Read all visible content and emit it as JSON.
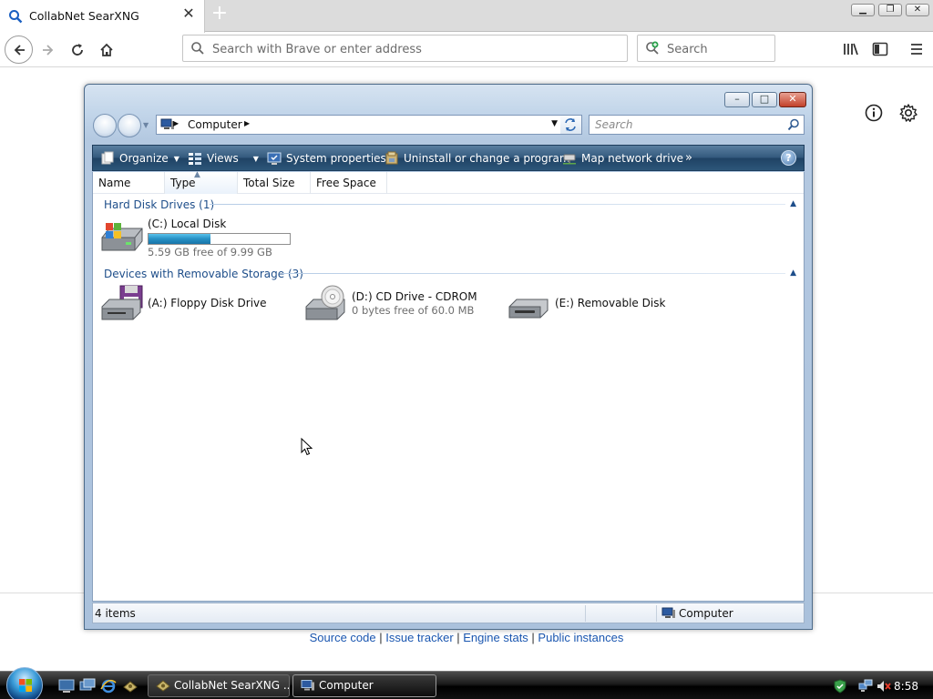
{
  "browser": {
    "tab_title": "CollabNet SearXNG",
    "url_placeholder": "Search with Brave or enter address",
    "search_placeholder": "Search"
  },
  "page_footer": {
    "links": [
      "Source code",
      "Issue tracker",
      "Engine stats",
      "Public instances"
    ],
    "separator": " | "
  },
  "explorer": {
    "breadcrumb": "Computer",
    "search_placeholder": "Search",
    "toolbar": {
      "organize": "Organize",
      "views": "Views",
      "system_properties": "System properties",
      "uninstall": "Uninstall or change a program",
      "map_drive": "Map network drive",
      "more": "»",
      "help": "?"
    },
    "columns": [
      "Name",
      "Type",
      "Total Size",
      "Free Space"
    ],
    "groups": {
      "hdd": {
        "label": "Hard Disk Drives (1)",
        "drives": [
          {
            "name": "(C:) Local Disk",
            "detail": "5.59 GB free of 9.99 GB",
            "used_fraction": 0.44
          }
        ]
      },
      "removable": {
        "label": "Devices with Removable Storage (3)",
        "drives": [
          {
            "name": "(A:) Floppy Disk Drive",
            "detail": ""
          },
          {
            "name": "(D:) CD Drive - CDROM",
            "detail": "0 bytes free of 60.0 MB"
          },
          {
            "name": "(E:) Removable Disk",
            "detail": ""
          }
        ]
      }
    },
    "status": {
      "items": "4 items",
      "location": "Computer"
    }
  },
  "taskbar": {
    "tasks": [
      "CollabNet SearXNG ...",
      "Computer"
    ],
    "clock": "8:58"
  }
}
